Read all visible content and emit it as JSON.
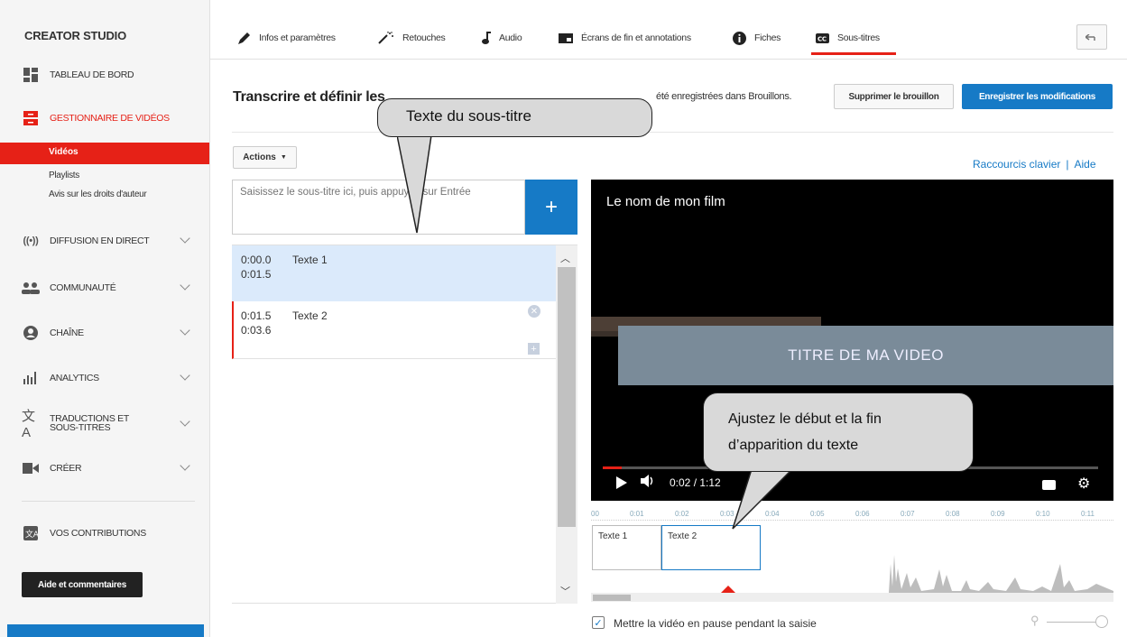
{
  "sidebar": {
    "brand": "CREATOR STUDIO",
    "items": [
      {
        "label": "TABLEAU DE BORD"
      },
      {
        "label": "GESTIONNAIRE DE VIDÉOS"
      },
      {
        "label": "DIFFUSION EN DIRECT"
      },
      {
        "label": "COMMUNAUTÉ"
      },
      {
        "label": "CHAÎNE"
      },
      {
        "label": "ANALYTICS"
      },
      {
        "label": "TRADUCTIONS ET SOUS-TITRES"
      },
      {
        "label": "CRÉER"
      },
      {
        "label": "VOS CONTRIBUTIONS"
      }
    ],
    "sub_items": [
      "Vidéos",
      "Playlists",
      "Avis sur les droits d'auteur"
    ],
    "help_button": "Aide et commentaires",
    "accent": "#e62117"
  },
  "tabs": [
    {
      "label": "Infos et paramètres",
      "icon": "pencil-icon"
    },
    {
      "label": "Retouches",
      "icon": "magic-wand-icon"
    },
    {
      "label": "Audio",
      "icon": "music-note-icon"
    },
    {
      "label": "Écrans de fin et annotations",
      "icon": "end-screen-icon"
    },
    {
      "label": "Fiches",
      "icon": "info-icon"
    },
    {
      "label": "Sous-titres",
      "icon": "cc-icon"
    }
  ],
  "header": {
    "title": "Transcrire et définir les",
    "draft_status": "été enregistrées dans Brouillons.",
    "delete_draft": "Supprimer le brouillon",
    "save": "Enregistrer les modifications"
  },
  "toolbar": {
    "actions": "Actions",
    "shortcuts": "Raccourcis clavier",
    "separator": "|",
    "help": "Aide"
  },
  "input": {
    "placeholder": "Saisissez le sous-titre ici, puis appuyez sur Entrée",
    "add": "+"
  },
  "subtitles": [
    {
      "start": "0:00.0",
      "end": "0:01.5",
      "text": "Texte 1"
    },
    {
      "start": "0:01.5",
      "end": "0:03.6",
      "text": "Texte 2"
    }
  ],
  "video": {
    "title": "Le nom de mon film",
    "banner": "TITRE DE MA VIDEO",
    "time": "0:02 / 1:12"
  },
  "timeline": {
    "ticks": [
      "00",
      "0:01",
      "0:02",
      "0:03",
      "0:04",
      "0:05",
      "0:06",
      "0:07",
      "0:08",
      "0:09",
      "0:10",
      "0:11"
    ],
    "captions": [
      "Texte 1",
      "Texte 2"
    ]
  },
  "footer": {
    "pause_label": "Mettre la vidéo en pause pendant la saisie",
    "pause_checked": true
  },
  "callouts": {
    "c1": "Texte du sous-titre",
    "c2_line1": "Ajustez le début et la fin",
    "c2_line2": "d’apparition du texte"
  },
  "colors": {
    "brand_blue": "#167ac6",
    "brand_red": "#e62117"
  }
}
